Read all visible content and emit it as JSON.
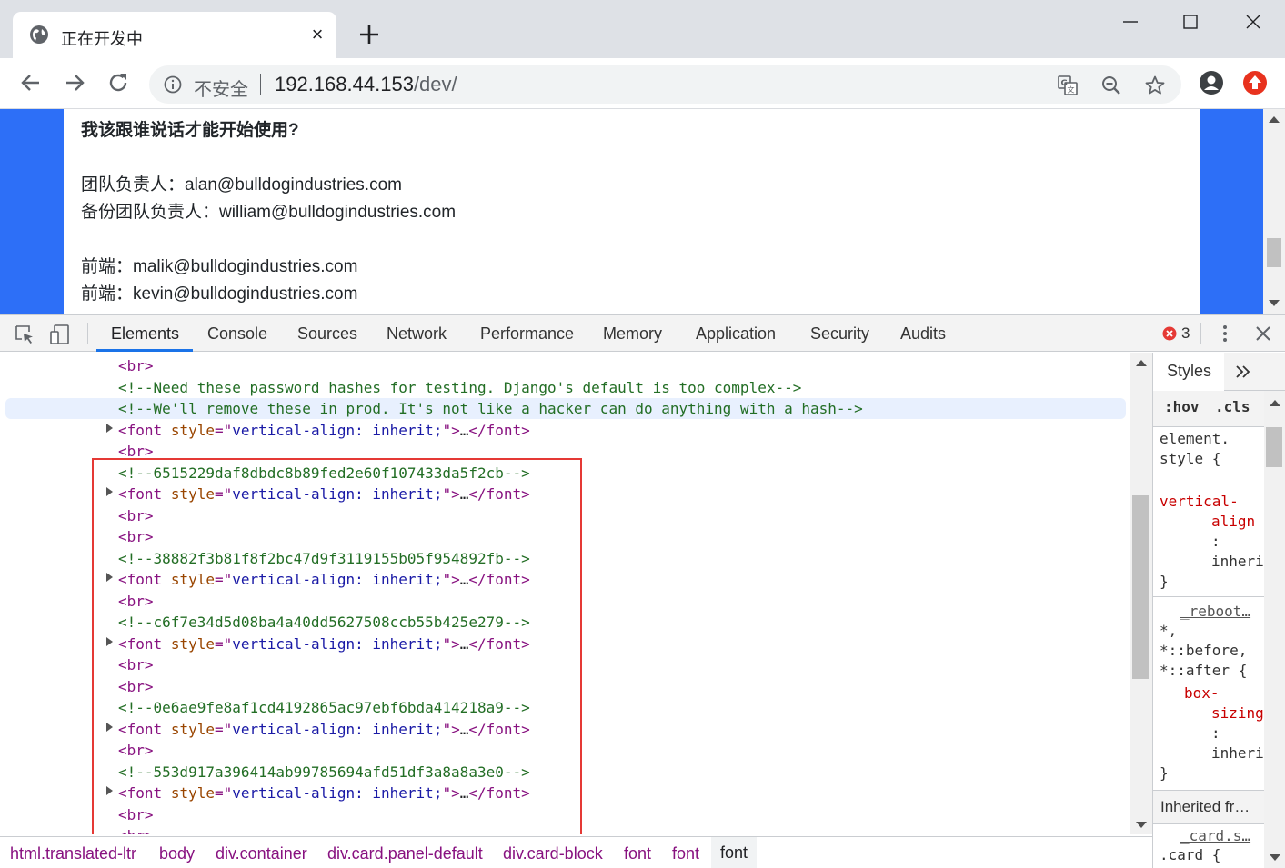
{
  "browser": {
    "tab_title": "正在开发中",
    "tab_close": "×",
    "security_label": "不安全",
    "url_host": "192.168.44.153",
    "url_path": "/dev/"
  },
  "page": {
    "heading": "我该跟谁说话才能开始使用?",
    "lines": [
      "团队负责人：alan@bulldogindustries.com",
      "备份团队负责人：william@bulldogindustries.com",
      "前端：malik@bulldogindustries.com",
      "前端：kevin@bulldogindustries.com"
    ]
  },
  "devtools": {
    "tabs": [
      "Elements",
      "Console",
      "Sources",
      "Network",
      "Performance",
      "Memory",
      "Application",
      "Security",
      "Audits"
    ],
    "active_tab": "Elements",
    "error_count": "3",
    "tree": {
      "br": "<br>",
      "comment_1": "<!--Need these password hashes for testing. Django's default is too complex-->",
      "comment_2": "<!--We'll remove these in prod. It's not like a hacker can do anything with a hash-->",
      "font_open": "<font",
      "font_attr": "style",
      "font_eq": "=\"",
      "font_val": "vertical-align: inherit;",
      "font_q": "\">",
      "font_dots": "…",
      "font_close": "</font>",
      "hash_1": "<!--6515229daf8dbdc8b89fed2e60f107433da5f2cb-->",
      "hash_2": "<!--38882f3b81f8f2bc47d9f3119155b05f954892fb-->",
      "hash_3": "<!--c6f7e34d5d08ba4a40dd5627508ccb55b425e279-->",
      "hash_4": "<!--0e6ae9fe8af1cd4192865ac97ebf6bda414218a9-->",
      "hash_5": "<!--553d917a396414ab99785694afd51df3a8a8a3e0-->",
      "br_partial": "<br>"
    },
    "breadcrumbs": [
      "html.translated-ltr",
      "body",
      "div.container",
      "div.card.panel-default",
      "div.card-block",
      "font",
      "font",
      "font"
    ],
    "styles": {
      "tab": "Styles",
      "hov": ":hov",
      "cls": ".cls",
      "element_style_1": "element.",
      "element_style_2": "style {",
      "prop_1": "vertical-",
      "prop_2": "align",
      "colon": ":",
      "value": "inheri",
      "close_brace": "}",
      "reboot_src": "_reboot…",
      "sel_1": "*,",
      "sel_2": "*::before,",
      "sel_3": "*::after {",
      "prop_b1": "box-",
      "prop_b2": "sizing",
      "inherited": "Inherited fr…",
      "card_src": "_card.s…",
      "card_sel": ".card {"
    }
  },
  "colors": {
    "page_bg": "#2d6ff7",
    "highlight_box": "#e53935",
    "active_tab_underline": "#1a73e8"
  }
}
